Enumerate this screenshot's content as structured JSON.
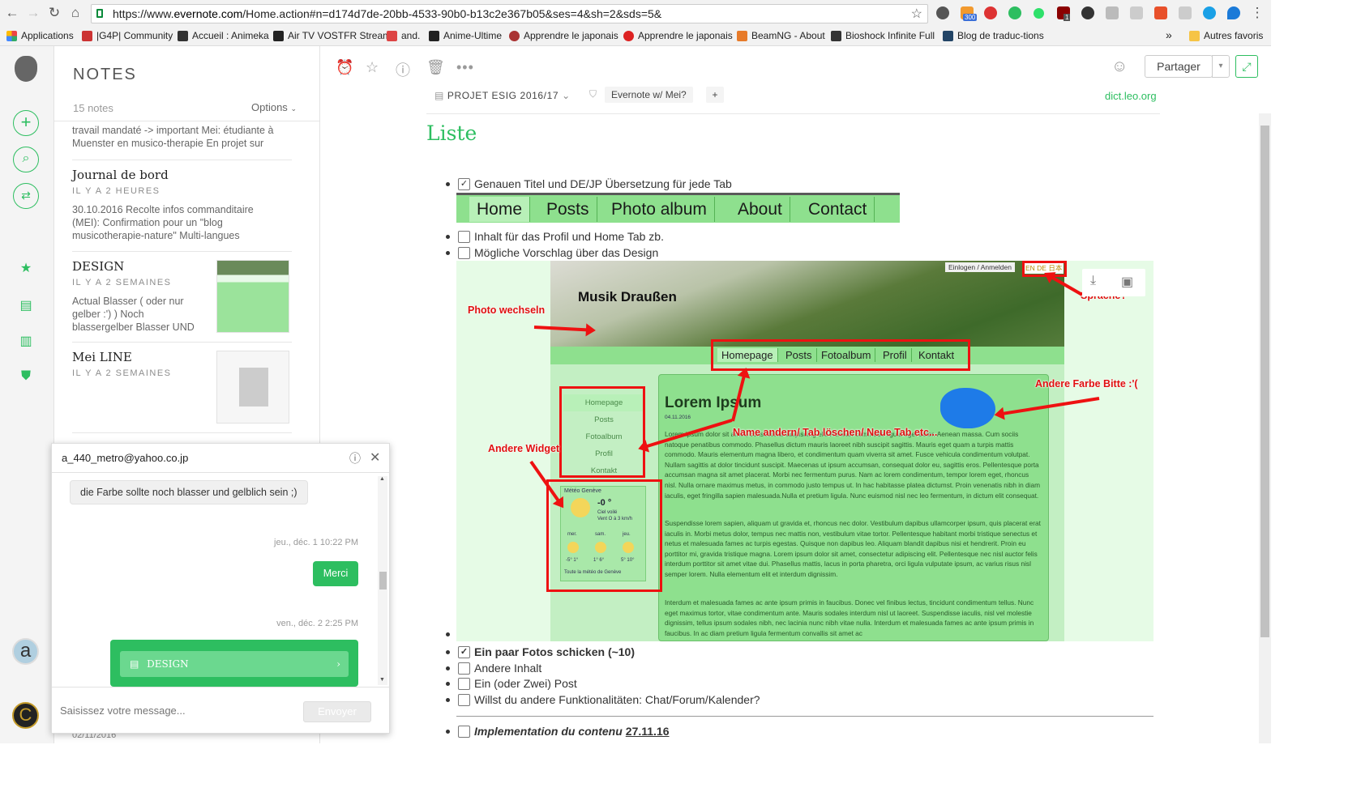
{
  "browser": {
    "url_prefix": "https://www.",
    "url_host": "evernote.com",
    "url_path": "/Home.action#n=d174d7de-20bb-4533-90b0-b13c2e367b05&ses=4&sh=2&sds=5&",
    "ext_badges": [
      "300",
      "1"
    ],
    "bookmarks": [
      "Applications",
      "|G4P| Community",
      "Accueil : Animeka",
      "Air TV VOSTFR Stream",
      "and.",
      "Anime-Ultime",
      "Apprendre le japonais",
      "Apprendre le japonais",
      "BeamNG - About",
      "Bioshock Infinite Full",
      "Blog de traduc-tions"
    ],
    "bookmarks_more": "»",
    "other_bookmarks": "Autres favoris"
  },
  "notes": {
    "title": "NOTES",
    "count": "15 notes",
    "options": "Options",
    "items": [
      {
        "title": "",
        "date": "",
        "snippet": "travail mandaté -> important Mei: étudiante à Muenster en musico-therapie En projet sur"
      },
      {
        "title": "Journal de bord",
        "date": "IL Y A 2 HEURES",
        "snippet": "30.10.2016 Recolte infos commanditaire (MEI): Confirmation pour un \"blog musicotherapie-nature\" Multi-langues"
      },
      {
        "title": "DESIGN",
        "date": "IL Y A 2 SEMAINES",
        "snippet": "Actual Blasser ( oder nur gelber :') ) Noch blassergelber Blasser UND"
      },
      {
        "title": "Mei LINE",
        "date": "IL Y A 2 SEMAINES",
        "snippet": ""
      }
    ],
    "bottom_date": "02/11/2016"
  },
  "editor": {
    "share": "Partager",
    "notebook": "PROJET ESIG 2016/17",
    "tag": "Evernote w/ Mei?",
    "tag_add": "+",
    "source": "dict.leo.org",
    "title": "Liste",
    "checklist": [
      {
        "text": "Genauen Titel und DE/JP Übersetzung für jede Tab",
        "checked": true
      },
      {
        "text": "Inhalt für das Profil und Home Tab zb.",
        "checked": false
      },
      {
        "text": "Mögliche Vorschlag über das Design",
        "checked": false
      },
      {
        "text": "Ein paar Fotos schicken (~10)",
        "checked": true
      },
      {
        "text": "Andere Inhalt",
        "checked": false
      },
      {
        "text": "Ein (oder Zwei) Post",
        "checked": false
      },
      {
        "text": "Willst du andere Funktionalitäten: Chat/Forum/Kalender?",
        "checked": false
      },
      {
        "text": "Implementation du contenu ",
        "date": "27.11.16",
        "checked": false
      }
    ],
    "nav_tabs": [
      "Home",
      "Posts",
      "Photo album",
      "About",
      "Contact"
    ]
  },
  "mockup": {
    "site_title": "Musik Draußen",
    "login": "Einlogen / Anmelden",
    "langs": "EN DE 日本",
    "nav": [
      "Homepage",
      "Posts",
      "Fotoalbum",
      "Profil",
      "Kontakt"
    ],
    "side": [
      "Homepage",
      "Posts",
      "Fotoalbum",
      "Profil",
      "Kontakt"
    ],
    "weather_title": "Météo Genève",
    "weather_temp": "-0 °",
    "weather_desc": "Ciel voilé",
    "weather_wind": "Vent   O à 3 km/h",
    "weather_days": [
      "mer.",
      "sam.",
      "jeu."
    ],
    "weather_temps": [
      "-5° 1°",
      "1° 6°",
      "5° 10°"
    ],
    "weather_link": "Toute la météo de Genève",
    "heading": "Lorem Ipsum",
    "date": "04.11.2016",
    "para1": "Lorem ipsum dolor sit amet, consectetur adipiscing elit. Aenean commodo ligula eget dolor. Aenean massa. Cum sociis natoque penatibus commodo. Phasellus dictum mauris laoreet nibh suscipit sagittis. Mauris eget quam a turpis mattis commodo. Mauris elementum magna libero, et condimentum quam viverra sit amet. Fusce vehicula condimentum volutpat. Nullam sagittis at dolor tincidunt suscipit. Maecenas ut ipsum accumsan, consequat dolor eu, sagittis eros. Pellentesque porta accumsan magna sit amet placerat. Morbi nec fermentum purus. Nam ac lorem condimentum, tempor lorem eget, rhoncus nisl. Nulla ornare maximus metus, in commodo justo tempus ut. In hac habitasse platea dictumst. Proin venenatis nibh in diam iaculis, eget fringilla sapien malesuada.Nulla et pretium ligula. Nunc euismod nisl nec leo fermentum, in dictum elit consequat.",
    "para2": "Suspendisse lorem sapien, aliquam ut gravida et, rhoncus nec dolor. Vestibulum dapibus ullamcorper ipsum, quis placerat erat iaculis in. Morbi metus dolor, tempus nec mattis non, vestibulum vitae tortor. Pellentesque habitant morbi tristique senectus et netus et malesuada fames ac turpis egestas. Quisque non dapibus leo. Aliquam blandit dapibus nisi et hendrerit. Proin eu porttitor mi, gravida tristique magna. Lorem ipsum dolor sit amet, consectetur adipiscing elit. Pellentesque nec nisl auctor felis interdum porttitor sit amet vitae dui. Phasellus mattis, lacus in porta pharetra, orci ligula vulputate ipsum, ac varius risus nisl semper lorem. Nulla elementum elit et interdum dignissim.",
    "para3": "Interdum et malesuada fames ac ante ipsum primis in faucibus. Donec vel finibus lectus, tincidunt condimentum tellus. Nunc eget maximus tortor, vitae condimentum ante. Mauris sodales interdum nisl ut laoreet. Suspendisse iaculis, nisl vel molestie dignissim, tellus ipsum sodales nibh, nec lacinia nunc nibh vitae nulla. Interdum et malesuada fames ac ante ipsum primis in faucibus. In ac diam pretium ligula fermentum convallis sit amet ac",
    "annotations": {
      "photo": "Photo wechseln",
      "widget": "Andere Widget",
      "tabs": "Name andern/ Tab löschen/ Neue Tab etc...",
      "color": "Andere Farbe Bitte :'(",
      "sprache": "Sprache?"
    }
  },
  "chat": {
    "email": "a_440_metro@yahoo.co.jp",
    "msg_in": "die Farbe sollte noch blasser und gelblich sein ;)",
    "ts1": "jeu., déc. 1 10:22 PM",
    "msg_out": "Merci",
    "ts2": "ven., déc. 2 2:25 PM",
    "card": "DESIGN",
    "placeholder": "Saisissez votre message...",
    "send": "Envoyer"
  }
}
